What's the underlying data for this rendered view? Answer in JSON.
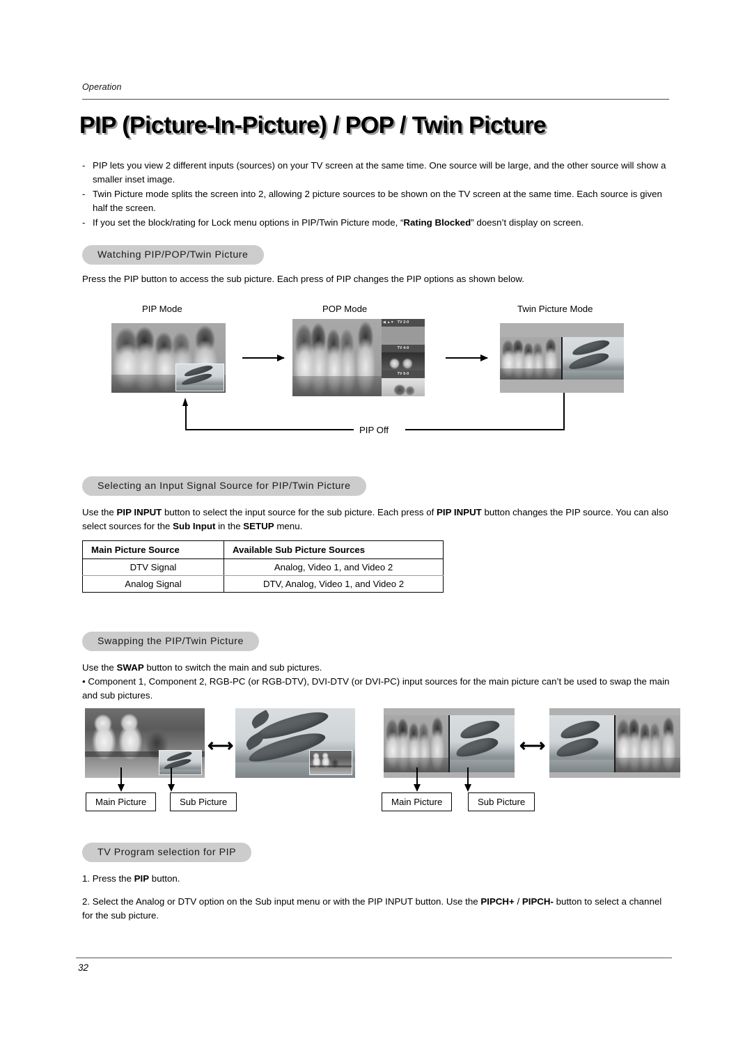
{
  "header": {
    "running_head": "Operation"
  },
  "title": "PIP (Picture-In-Picture) / POP / Twin Picture",
  "intro": {
    "dash": "-",
    "items": [
      "PIP lets you view 2 different inputs (sources) on your TV screen at the same time. One source will be large, and the other source will show a smaller inset image.",
      "Twin Picture mode splits the screen into 2, allowing 2 picture sources to be shown on the TV screen at the same time. Each source is given half the screen."
    ],
    "item3_pre": "If you set the block/rating for Lock menu options in PIP/Twin Picture mode, “",
    "item3_bold": "Rating Blocked",
    "item3_post": "” doesn’t display on screen."
  },
  "section_watching": {
    "heading": "Watching PIP/POP/Twin Picture",
    "intro": "Press the PIP button to access the sub picture. Each press of PIP changes the PIP options as shown below.",
    "captions": {
      "pip": "PIP Mode",
      "pop": "POP Mode",
      "twin": "Twin Picture Mode"
    },
    "pop_channels": [
      "TV 2-0",
      "TV 4-0",
      "TV 6-0"
    ],
    "pip_off_label": "PIP Off"
  },
  "section_input": {
    "heading": "Selecting an Input Signal Source for PIP/Twin Picture",
    "para1_a": "Use the ",
    "para1_b1": "PIP INPUT",
    "para1_b": " button to select the input source for the sub picture. Each press of ",
    "para1_b2": "PIP INPUT",
    "para1_c": " button changes the PIP source. You can also select sources for the ",
    "para1_b3": "Sub Input",
    "para1_d": " in the ",
    "para1_b4": "SETUP",
    "para1_e": " menu.",
    "table": {
      "columns": [
        "Main Picture Source",
        "Available Sub Picture Sources"
      ],
      "rows": [
        [
          "DTV Signal",
          "Analog, Video 1, and Video 2"
        ],
        [
          "Analog Signal",
          "DTV, Analog, Video 1, and Video 2"
        ]
      ]
    }
  },
  "section_swap": {
    "heading": "Swapping the PIP/Twin Picture",
    "para1_a": "Use the ",
    "para1_b": "SWAP",
    "para1_c": " button to switch the main and sub pictures.",
    "bullet": "• Component 1, Component 2, RGB-PC (or RGB-DTV), DVI-DTV (or DVI-PC) input sources for the main picture can’t be used to swap the main and sub pictures.",
    "labels": {
      "main": "Main Picture",
      "sub": "Sub Picture"
    }
  },
  "section_tvprogram": {
    "heading": "TV Program selection for PIP",
    "step1_num": "1.",
    "step1_a": "Press the ",
    "step1_b": "PIP",
    "step1_c": " button.",
    "step2_num": "2.",
    "step2_a": "Select the Analog or DTV option on the Sub input menu or with the PIP INPUT button. Use the ",
    "step2_b1": "PIPCH+",
    "step2_mid": " / ",
    "step2_b2": "PIPCH-",
    "step2_c": " button to select a channel for the sub picture."
  },
  "footer": {
    "page_number": "32"
  },
  "colors": {
    "pill_background": "#cccccc",
    "text": "#000000",
    "rule": "#4a4a4a",
    "osd_bar": "#4d4d4d"
  }
}
